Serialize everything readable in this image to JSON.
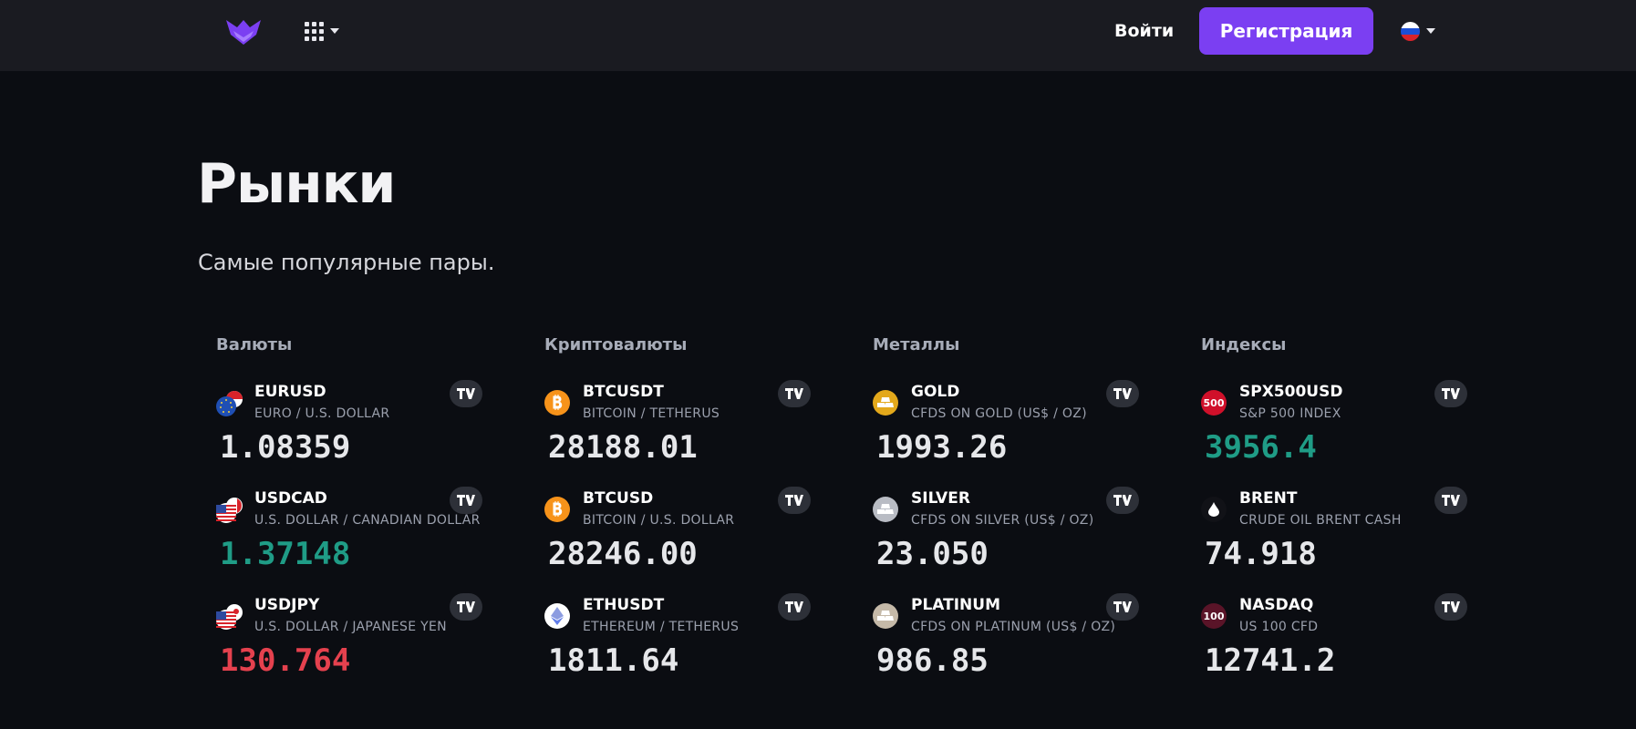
{
  "header": {
    "login_label": "Войти",
    "register_label": "Регистрация",
    "accent_color": "#7b3ff2",
    "app_menu_icon": "grid-icon",
    "language_flag": "russia-flag"
  },
  "page": {
    "title": "Рынки",
    "subtitle": "Самые популярные пары."
  },
  "columns": [
    {
      "title": "Валюты",
      "items": [
        {
          "symbol": "EURUSD",
          "description": "EURO / U.S. DOLLAR",
          "price": "1.08359",
          "price_color": "#e6e7ea",
          "icon": "eur-usd-flags-icon"
        },
        {
          "symbol": "USDCAD",
          "description": "U.S. DOLLAR / CANADIAN DOLLAR",
          "price": "1.37148",
          "price_color": "#1f9c86",
          "icon": "usd-cad-flags-icon"
        },
        {
          "symbol": "USDJPY",
          "description": "U.S. DOLLAR / JAPANESE YEN",
          "price": "130.764",
          "price_color": "#e5414e",
          "icon": "usd-jpy-flags-icon"
        }
      ]
    },
    {
      "title": "Криптовалюты",
      "items": [
        {
          "symbol": "BTCUSDT",
          "description": "BITCOIN / TETHERUS",
          "price": "28188.01",
          "price_color": "#e6e7ea",
          "icon": "bitcoin-icon"
        },
        {
          "symbol": "BTCUSD",
          "description": "BITCOIN / U.S. DOLLAR",
          "price": "28246.00",
          "price_color": "#e6e7ea",
          "icon": "bitcoin-icon"
        },
        {
          "symbol": "ETHUSDT",
          "description": "ETHEREUM / TETHERUS",
          "price": "1811.64",
          "price_color": "#e6e7ea",
          "icon": "ethereum-icon"
        }
      ]
    },
    {
      "title": "Металлы",
      "items": [
        {
          "symbol": "GOLD",
          "description": "CFDS ON GOLD (US$ / OZ)",
          "price": "1993.26",
          "price_color": "#e6e7ea",
          "icon": "gold-bars-icon"
        },
        {
          "symbol": "SILVER",
          "description": "CFDS ON SILVER (US$ / OZ)",
          "price": "23.050",
          "price_color": "#e6e7ea",
          "icon": "silver-bars-icon"
        },
        {
          "symbol": "PLATINUM",
          "description": "CFDS ON PLATINUM (US$ / OZ)",
          "price": "986.85",
          "price_color": "#e6e7ea",
          "icon": "platinum-bars-icon"
        }
      ]
    },
    {
      "title": "Индексы",
      "items": [
        {
          "symbol": "SPX500USD",
          "description": "S&P 500 INDEX",
          "price": "3956.4",
          "price_color": "#1f9c86",
          "icon": "spx500-badge-icon",
          "badge_text": "500"
        },
        {
          "symbol": "BRENT",
          "description": "CRUDE OIL BRENT CASH",
          "price": "74.918",
          "price_color": "#e6e7ea",
          "icon": "oil-drop-icon"
        },
        {
          "symbol": "NASDAQ",
          "description": "US 100 CFD",
          "price": "12741.2",
          "price_color": "#e6e7ea",
          "icon": "nasdaq-badge-icon",
          "badge_text": "100"
        }
      ]
    }
  ]
}
